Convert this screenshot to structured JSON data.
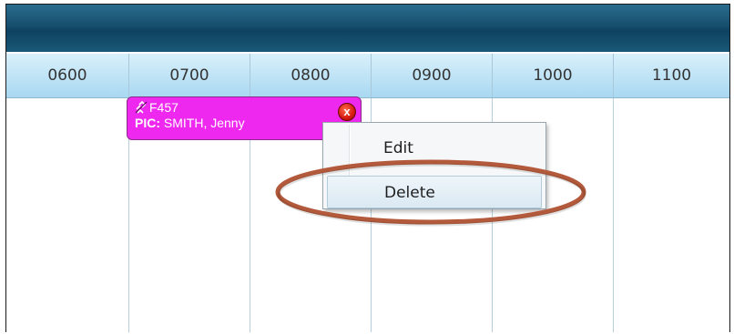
{
  "timeline": {
    "hours": [
      "0600",
      "0700",
      "0800",
      "0900",
      "1000",
      "1100"
    ]
  },
  "flight_block": {
    "flight_number": "F457",
    "pic_label": "PIC:",
    "pic_name": "SMITH, Jenny",
    "close_glyph": "x",
    "color": "#ee28ee",
    "icon": "link-broken-icon"
  },
  "context_menu": {
    "items": [
      {
        "label": "Edit",
        "highlighted": false
      },
      {
        "label": "Delete",
        "highlighted": true
      }
    ]
  },
  "annotation": {
    "ellipse_color": "#b35a3c"
  }
}
